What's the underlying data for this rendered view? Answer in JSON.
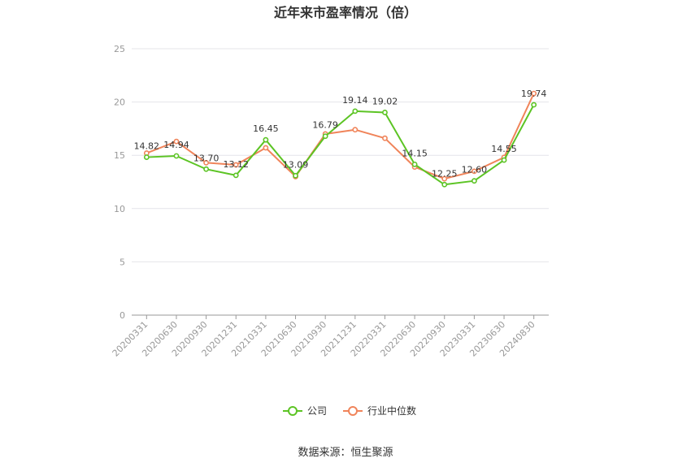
{
  "title": "近年来市盈率情况（倍）",
  "source": "数据来源：恒生聚源",
  "colors": {
    "company": "#5cc424",
    "industry": "#f0845a",
    "grid": "#e4e4ea",
    "axis": "#999999"
  },
  "chart_data": {
    "type": "line",
    "title": "近年来市盈率情况（倍）",
    "categories": [
      "20200331",
      "20200630",
      "20200930",
      "20201231",
      "20210331",
      "20210630",
      "20210930",
      "20211231",
      "20220331",
      "20220630",
      "20220930",
      "20230331",
      "20230630",
      "20240830"
    ],
    "ylim": [
      0,
      25
    ],
    "yticks": [
      0,
      5,
      10,
      15,
      20,
      25
    ],
    "grid": true,
    "legend": "bottom-center",
    "series": [
      {
        "name": "公司",
        "color": "#5cc424",
        "labeled": true,
        "values": [
          14.82,
          14.94,
          13.7,
          13.12,
          16.45,
          13.09,
          16.79,
          19.14,
          19.02,
          14.15,
          12.25,
          12.6,
          14.55,
          19.74
        ]
      },
      {
        "name": "行业中位数",
        "color": "#f0845a",
        "labeled": false,
        "values": [
          15.2,
          16.3,
          14.3,
          14.1,
          15.7,
          13.0,
          17.0,
          17.4,
          16.6,
          13.9,
          12.8,
          13.5,
          14.8,
          20.8
        ]
      }
    ]
  }
}
